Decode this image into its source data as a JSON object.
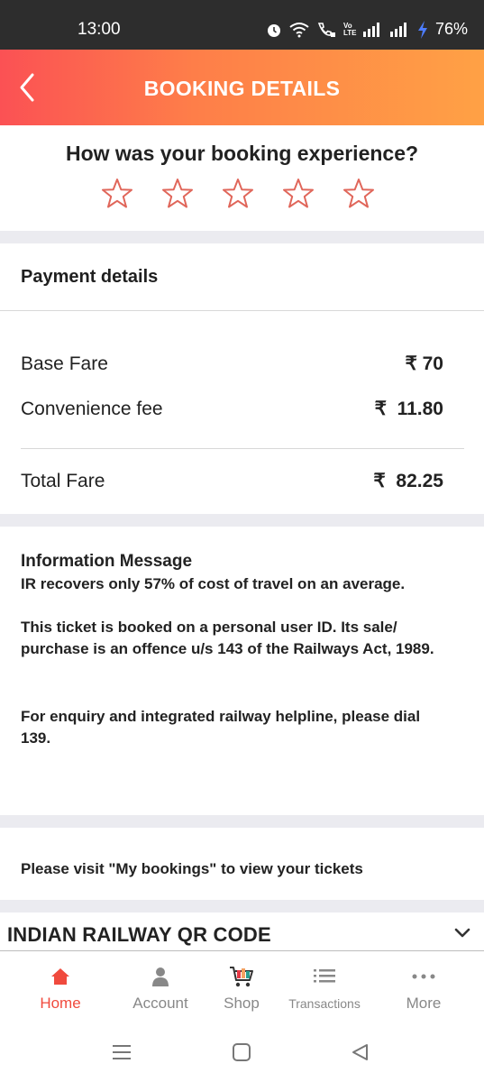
{
  "status_bar": {
    "time": "13:00",
    "battery": "76%",
    "network_label": "Vo LTE"
  },
  "header": {
    "title": "BOOKING DETAILS"
  },
  "rating": {
    "question": "How was your booking experience?",
    "star_count": 5
  },
  "payment": {
    "heading": "Payment details",
    "rows": [
      {
        "label": "Base Fare",
        "value": "₹ 70"
      },
      {
        "label": "Convenience fee",
        "value": "₹  11.80"
      }
    ],
    "total": {
      "label": "Total Fare",
      "value": "₹  82.25"
    }
  },
  "info": {
    "title": "Information Message",
    "lines": [
      "IR recovers only 57% of cost of travel on an average.",
      "This ticket is booked on a personal user ID. Its sale/ purchase is an offence u/s 143 of the Railways Act, 1989.",
      "For enquiry and integrated railway helpline, please dial 139."
    ]
  },
  "visit_message": "Please visit \"My bookings\" to view your tickets",
  "qr_section": {
    "title": "INDIAN RAILWAY QR CODE"
  },
  "bottom_nav": {
    "items": [
      {
        "label": "Home",
        "icon": "home-icon",
        "active": true
      },
      {
        "label": "Account",
        "icon": "person-icon",
        "active": false
      },
      {
        "label": "Shop",
        "icon": "shopping-cart-icon",
        "active": false
      },
      {
        "label": "Transactions",
        "icon": "list-icon",
        "active": false
      },
      {
        "label": "More",
        "icon": "more-dots-icon",
        "active": false
      }
    ]
  },
  "colors": {
    "accent": "#f04a3d",
    "header_start": "#fb5154",
    "header_end": "#ffa145",
    "star": "#e0665a"
  }
}
